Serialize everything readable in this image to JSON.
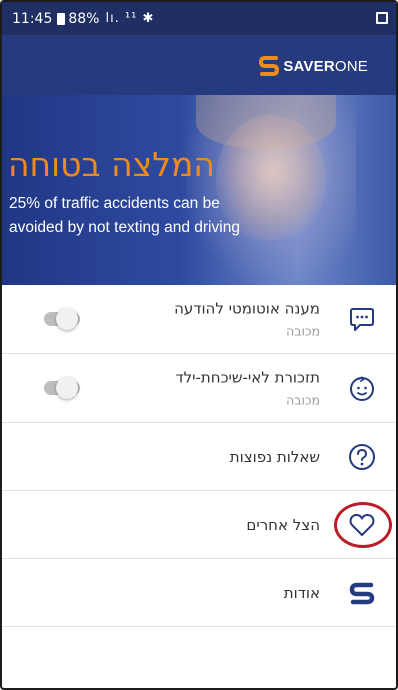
{
  "status_bar": {
    "time": "11:45",
    "battery": "88%",
    "signal_icons": "lı. ¹¹ ✱"
  },
  "app": {
    "logo_brand_bold": "SAVER",
    "logo_brand_light": "ONE",
    "accent_color": "#f08a1c",
    "header_color": "#263a80"
  },
  "hero": {
    "title": "המלצה בטוחה",
    "subtitle": "25% of traffic accidents can be avoided by not texting and driving"
  },
  "list": {
    "items": [
      {
        "title": "מענה אוטומטי להודעה",
        "subtitle": "מכובה",
        "icon": "message-bubble-icon",
        "has_toggle": true,
        "toggle_on": false
      },
      {
        "title": "תזכורת לאי-שיכחת-ילד",
        "subtitle": "מכובה",
        "icon": "baby-face-icon",
        "has_toggle": true,
        "toggle_on": false
      },
      {
        "title": "שאלות נפוצות",
        "icon": "question-circle-icon"
      },
      {
        "title": "הצל אחרים",
        "icon": "heart-icon",
        "highlight_color": "#b81e2a"
      },
      {
        "title": "אודות",
        "icon": "saverone-s-icon"
      }
    ]
  }
}
